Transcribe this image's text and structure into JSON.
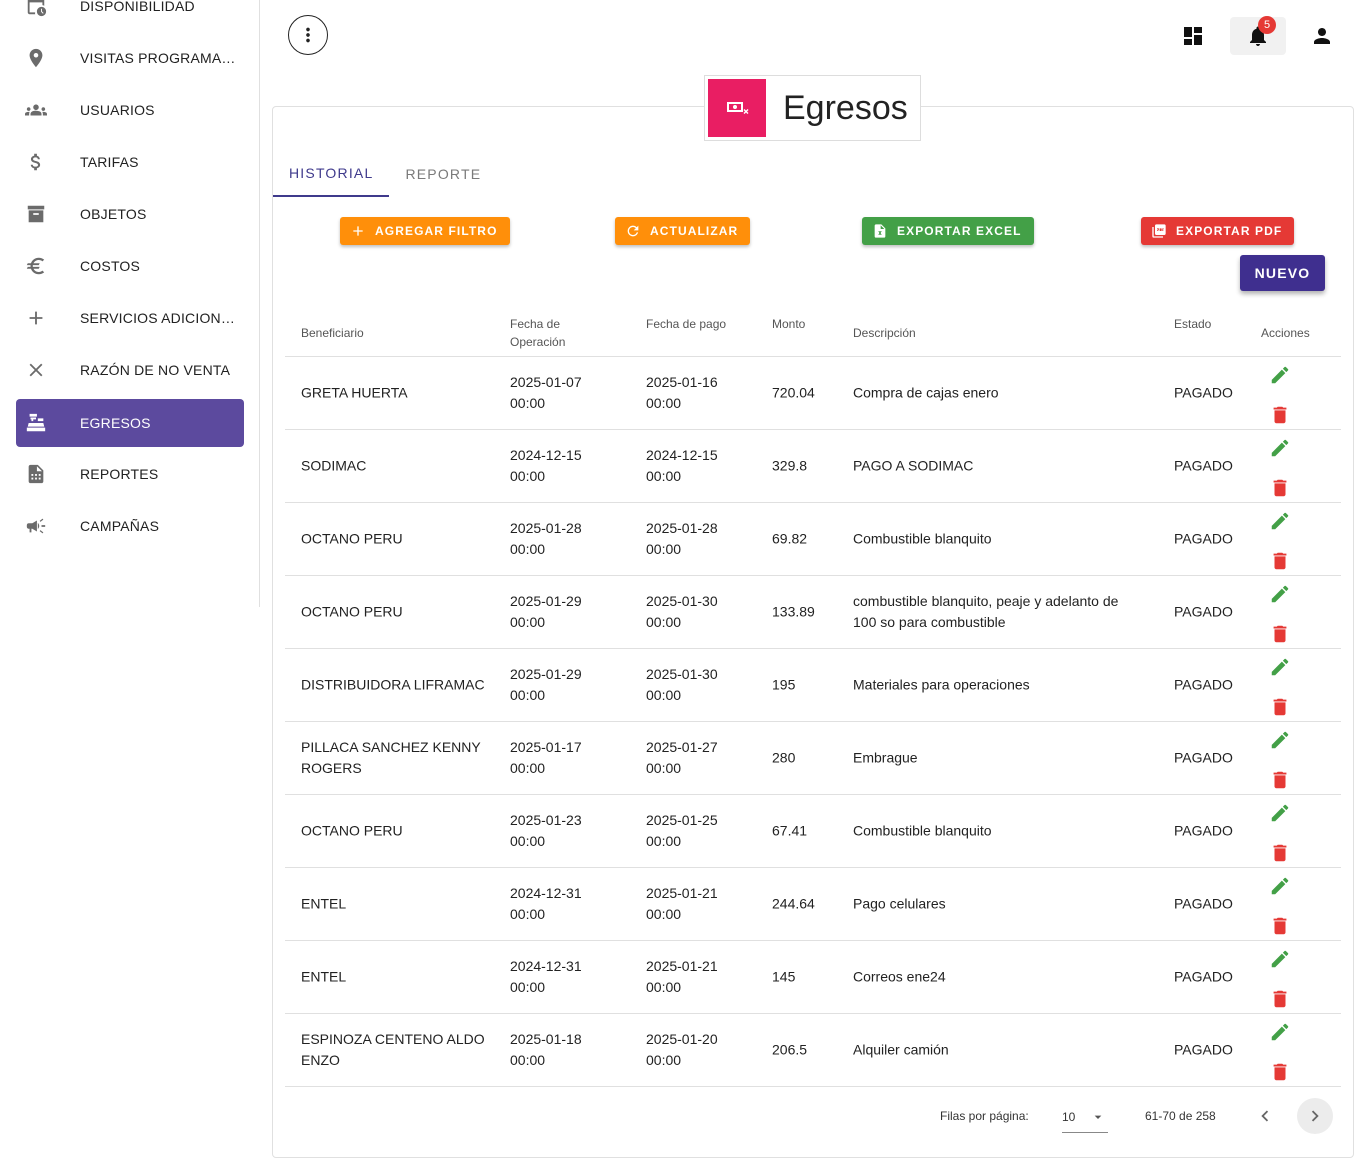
{
  "sidebar": {
    "items": [
      {
        "label": "DISPONIBILIDAD",
        "icon": "calendar-clock-icon"
      },
      {
        "label": "VISITAS PROGRAMADAS",
        "icon": "location-pin-icon"
      },
      {
        "label": "USUARIOS",
        "icon": "users-icon"
      },
      {
        "label": "TARIFAS",
        "icon": "dollar-icon"
      },
      {
        "label": "OBJETOS",
        "icon": "archive-icon"
      },
      {
        "label": "COSTOS",
        "icon": "euro-icon"
      },
      {
        "label": "SERVICIOS ADICIONALES",
        "icon": "plus-icon"
      },
      {
        "label": "RAZÓN DE NO VENTA",
        "icon": "close-icon"
      },
      {
        "label": "EGRESOS",
        "icon": "cash-register-icon",
        "active": true
      },
      {
        "label": "REPORTES",
        "icon": "report-icon"
      },
      {
        "label": "CAMPAÑAS",
        "icon": "megaphone-icon"
      }
    ]
  },
  "topbar": {
    "notifications_count": "5"
  },
  "page": {
    "title": "Egresos",
    "header_color": "#e91e63"
  },
  "tabs": [
    {
      "label": "HISTORIAL",
      "active": true
    },
    {
      "label": "REPORTE",
      "active": false
    }
  ],
  "toolbar": {
    "add_filter": "AGREGAR FILTRO",
    "refresh": "ACTUALIZAR",
    "export_excel": "EXPORTAR EXCEL",
    "export_pdf": "EXPORTAR PDF",
    "new": "NUEVO"
  },
  "table": {
    "headers": {
      "beneficiario": "Beneficiario",
      "fecha_operacion_1": "Fecha de",
      "fecha_operacion_2": "Operación",
      "fecha_pago": "Fecha de pago",
      "monto": "Monto",
      "descripcion": "Descripción",
      "estado": "Estado",
      "acciones": "Acciones"
    },
    "rows": [
      {
        "beneficiario": [
          "GRETA HUERTA"
        ],
        "fecha_op": [
          "2025-01-07",
          "00:00"
        ],
        "fecha_pago": [
          "2025-01-16",
          "00:00"
        ],
        "monto": "720.04",
        "descripcion": [
          "Compra de cajas enero"
        ],
        "estado": "PAGADO"
      },
      {
        "beneficiario": [
          "SODIMAC"
        ],
        "fecha_op": [
          "2024-12-15",
          "00:00"
        ],
        "fecha_pago": [
          "2024-12-15",
          "00:00"
        ],
        "monto": "329.8",
        "descripcion": [
          "PAGO A SODIMAC"
        ],
        "estado": "PAGADO"
      },
      {
        "beneficiario": [
          "OCTANO PERU"
        ],
        "fecha_op": [
          "2025-01-28",
          "00:00"
        ],
        "fecha_pago": [
          "2025-01-28",
          "00:00"
        ],
        "monto": "69.82",
        "descripcion": [
          "Combustible blanquito"
        ],
        "estado": "PAGADO"
      },
      {
        "beneficiario": [
          "OCTANO PERU"
        ],
        "fecha_op": [
          "2025-01-29",
          "00:00"
        ],
        "fecha_pago": [
          "2025-01-30",
          "00:00"
        ],
        "monto": "133.89",
        "descripcion": [
          "combustible blanquito, peaje y adelanto de",
          "100 so para combustible"
        ],
        "estado": "PAGADO"
      },
      {
        "beneficiario": [
          "DISTRIBUIDORA LIFRAMAC"
        ],
        "fecha_op": [
          "2025-01-29",
          "00:00"
        ],
        "fecha_pago": [
          "2025-01-30",
          "00:00"
        ],
        "monto": "195",
        "descripcion": [
          "Materiales para operaciones"
        ],
        "estado": "PAGADO"
      },
      {
        "beneficiario": [
          "PILLACA SANCHEZ KENNY",
          "ROGERS"
        ],
        "fecha_op": [
          "2025-01-17",
          "00:00"
        ],
        "fecha_pago": [
          "2025-01-27",
          "00:00"
        ],
        "monto": "280",
        "descripcion": [
          "Embrague"
        ],
        "estado": "PAGADO"
      },
      {
        "beneficiario": [
          "OCTANO PERU"
        ],
        "fecha_op": [
          "2025-01-23",
          "00:00"
        ],
        "fecha_pago": [
          "2025-01-25",
          "00:00"
        ],
        "monto": "67.41",
        "descripcion": [
          "Combustible blanquito"
        ],
        "estado": "PAGADO"
      },
      {
        "beneficiario": [
          "ENTEL"
        ],
        "fecha_op": [
          "2024-12-31",
          "00:00"
        ],
        "fecha_pago": [
          "2025-01-21",
          "00:00"
        ],
        "monto": "244.64",
        "descripcion": [
          "Pago celulares"
        ],
        "estado": "PAGADO"
      },
      {
        "beneficiario": [
          "ENTEL"
        ],
        "fecha_op": [
          "2024-12-31",
          "00:00"
        ],
        "fecha_pago": [
          "2025-01-21",
          "00:00"
        ],
        "monto": "145",
        "descripcion": [
          "Correos ene24"
        ],
        "estado": "PAGADO"
      },
      {
        "beneficiario": [
          "ESPINOZA CENTENO ALDO",
          "ENZO"
        ],
        "fecha_op": [
          "2025-01-18",
          "00:00"
        ],
        "fecha_pago": [
          "2025-01-20",
          "00:00"
        ],
        "monto": "206.5",
        "descripcion": [
          "Alquiler camión"
        ],
        "estado": "PAGADO"
      }
    ]
  },
  "pagination": {
    "rows_per_page_label": "Filas por página:",
    "rows_per_page": "10",
    "range": "61-70 de 258"
  },
  "colors": {
    "accent": "#5c4a9e",
    "primary": "#3f2f8f",
    "orange": "#ff8f0a",
    "green": "#43a047",
    "red": "#e53935"
  }
}
